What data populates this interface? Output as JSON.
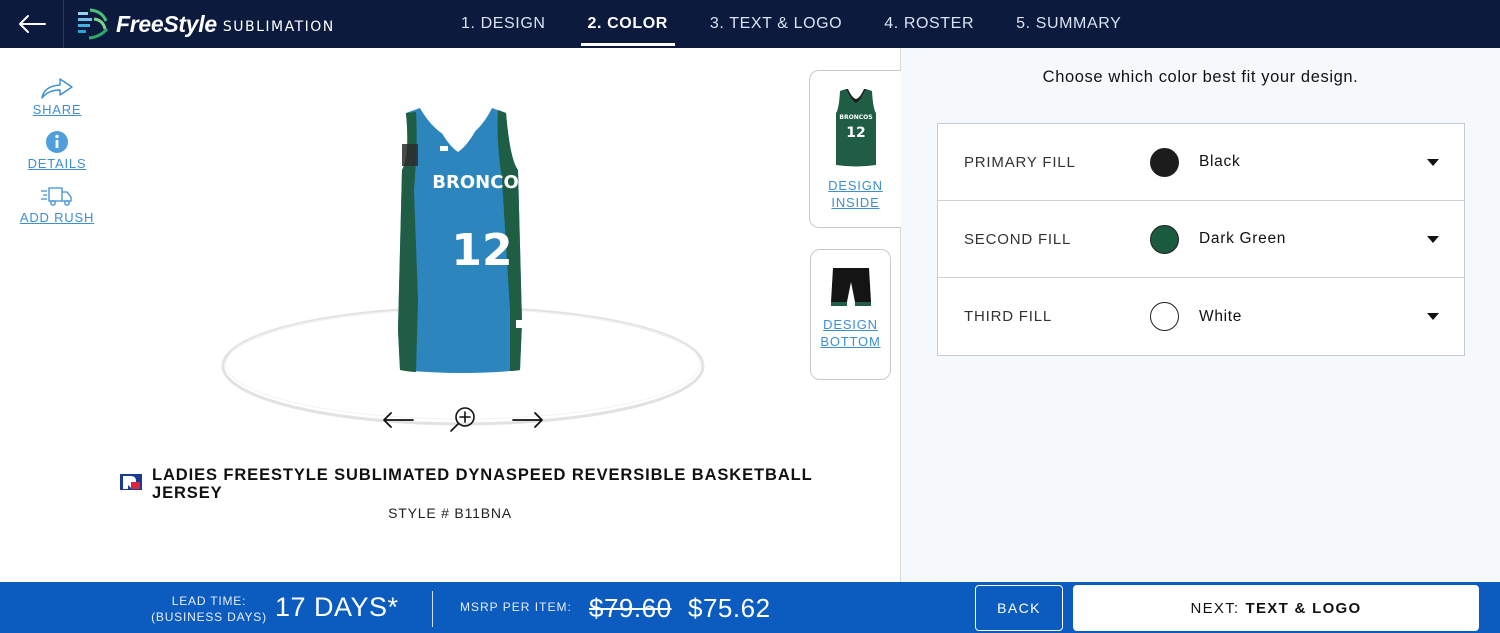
{
  "header": {
    "logo_word": "FreeStyle",
    "logo_sub": "SUBLIMATION",
    "steps": [
      {
        "label": "1. DESIGN"
      },
      {
        "label": "2. COLOR"
      },
      {
        "label": "3. TEXT & LOGO"
      },
      {
        "label": "4. ROSTER"
      },
      {
        "label": "5. SUMMARY"
      }
    ],
    "active_step": "2. COLOR"
  },
  "tools": {
    "share": "SHARE",
    "details": "DETAILS",
    "add_rush": "ADD RUSH"
  },
  "jersey": {
    "team_text": "BRONCOS",
    "number": "12"
  },
  "design_tabs": {
    "inside_line1": "DESIGN",
    "inside_line2": "INSIDE",
    "bottom_line1": "DESIGN",
    "bottom_line2": "BOTTOM"
  },
  "product": {
    "title": "LADIES FREESTYLE SUBLIMATED DYNASPEED REVERSIBLE BASKETBALL JERSEY",
    "style": "STYLE # B11BNA"
  },
  "color_panel": {
    "heading": "Choose which color best fit your design.",
    "fills": [
      {
        "label": "PRIMARY FILL",
        "value": "Black",
        "color": "#1c1c1c"
      },
      {
        "label": "SECOND FILL",
        "value": "Dark Green",
        "color": "#1a5a3f"
      },
      {
        "label": "THIRD FILL",
        "value": "White",
        "color": "#ffffff"
      }
    ]
  },
  "footer": {
    "lead_label_1": "LEAD TIME:",
    "lead_label_2": "(BUSINESS DAYS)",
    "lead_value": "17 DAYS*",
    "msrp_label": "MSRP PER ITEM:",
    "price_old": "$79.60",
    "price_new": "$75.62",
    "back_label": "BACK",
    "next_prefix": "NEXT:",
    "next_label": "TEXT & LOGO"
  },
  "colors": {
    "header_bg": "#0b1a3d",
    "footer_bg": "#0c5bbf",
    "link": "#3d8fd1",
    "jersey_blue": "#2c86bd",
    "jersey_green": "#1f5e45"
  }
}
